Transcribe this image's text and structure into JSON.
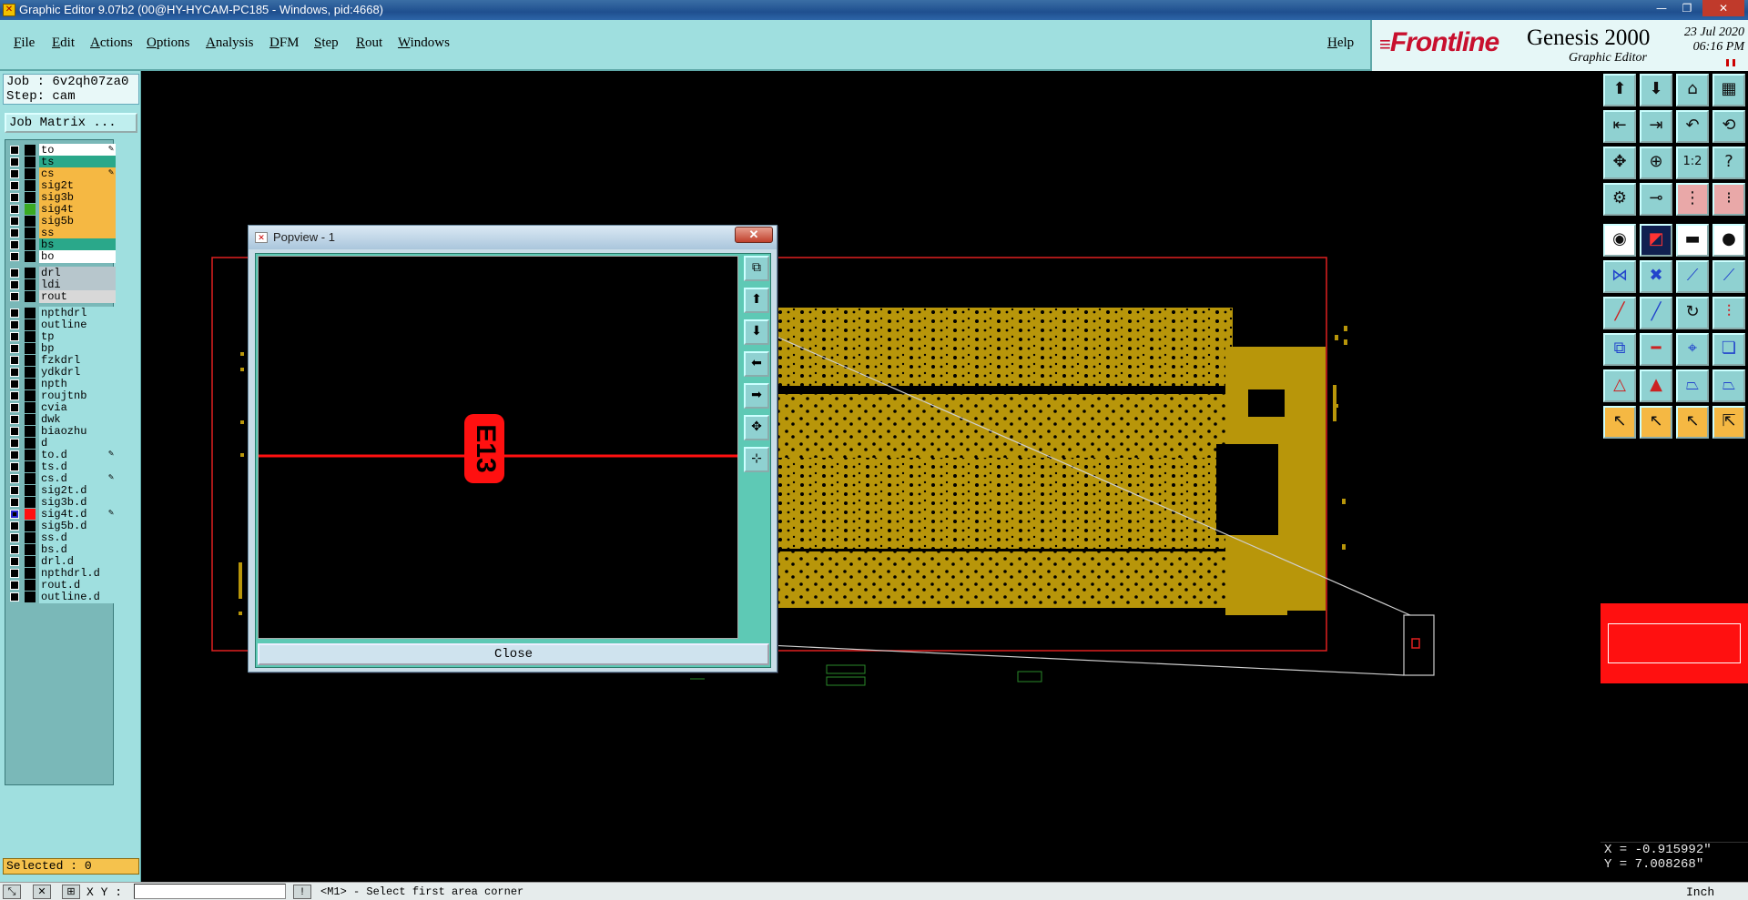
{
  "window": {
    "title": "Graphic Editor 9.07b2 (00@HY-HYCAM-PC185 - Windows, pid:4668)",
    "app_icon": "graphic-editor-icon",
    "controls": [
      "minimize",
      "restore",
      "close"
    ]
  },
  "menu": {
    "items": [
      "File",
      "Edit",
      "Actions",
      "Options",
      "Analysis",
      "DFM",
      "Step",
      "Rout",
      "Windows"
    ],
    "help": "Help"
  },
  "brand": {
    "logo": "Frontline",
    "product": "Genesis 2000",
    "subtitle": "Graphic Editor",
    "date": "23 Jul 2020",
    "time": "06:16 PM"
  },
  "left": {
    "job": "Job : 6v2qh07za0",
    "step": "Step: cam",
    "job_matrix": "Job Matrix ...",
    "selected": "Selected : 0",
    "layers": [
      {
        "name": "to",
        "bg": "#ffffff",
        "swatch": "",
        "edit": true
      },
      {
        "name": "ts",
        "bg": "#2aa88a",
        "swatch": "",
        "edit": false
      },
      {
        "name": "cs",
        "bg": "#f5b843",
        "swatch": "",
        "edit": true
      },
      {
        "name": "sig2t",
        "bg": "#f5b843",
        "swatch": "",
        "edit": false
      },
      {
        "name": "sig3b",
        "bg": "#f5b843",
        "swatch": "",
        "edit": false
      },
      {
        "name": "sig4t",
        "bg": "#f5b843",
        "swatch": "#3aaa22",
        "edit": false
      },
      {
        "name": "sig5b",
        "bg": "#f5b843",
        "swatch": "",
        "edit": false
      },
      {
        "name": "ss",
        "bg": "#f5b843",
        "swatch": "",
        "edit": false
      },
      {
        "name": "bs",
        "bg": "#2aa88a",
        "swatch": "",
        "edit": false
      },
      {
        "name": "bo",
        "bg": "#ffffff",
        "swatch": "",
        "edit": false
      },
      {
        "name": "drl",
        "bg": "#b7c6cc",
        "swatch": "",
        "edit": false
      },
      {
        "name": "ldi",
        "bg": "#b7c6cc",
        "swatch": "",
        "edit": false
      },
      {
        "name": "rout",
        "bg": "#d8d8d8",
        "swatch": "",
        "edit": false
      },
      {
        "name": "npthdrl",
        "bg": "#9fdfdf",
        "swatch": "",
        "edit": false
      },
      {
        "name": "outline",
        "bg": "#9fdfdf",
        "swatch": "",
        "edit": false
      },
      {
        "name": "tp",
        "bg": "#9fdfdf",
        "swatch": "",
        "edit": false
      },
      {
        "name": "bp",
        "bg": "#9fdfdf",
        "swatch": "",
        "edit": false
      },
      {
        "name": "fzkdrl",
        "bg": "#9fdfdf",
        "swatch": "",
        "edit": false
      },
      {
        "name": "ydkdrl",
        "bg": "#9fdfdf",
        "swatch": "",
        "edit": false
      },
      {
        "name": "npth",
        "bg": "#9fdfdf",
        "swatch": "",
        "edit": false
      },
      {
        "name": "roujtnb",
        "bg": "#9fdfdf",
        "swatch": "",
        "edit": false
      },
      {
        "name": "cvia",
        "bg": "#9fdfdf",
        "swatch": "",
        "edit": false
      },
      {
        "name": "dwk",
        "bg": "#9fdfdf",
        "swatch": "",
        "edit": false
      },
      {
        "name": "biaozhu",
        "bg": "#9fdfdf",
        "swatch": "",
        "edit": false
      },
      {
        "name": "d",
        "bg": "#9fdfdf",
        "swatch": "",
        "edit": false
      },
      {
        "name": "to.d",
        "bg": "#9fdfdf",
        "swatch": "",
        "edit": true
      },
      {
        "name": "ts.d",
        "bg": "#9fdfdf",
        "swatch": "",
        "edit": false
      },
      {
        "name": "cs.d",
        "bg": "#9fdfdf",
        "swatch": "",
        "edit": true
      },
      {
        "name": "sig2t.d",
        "bg": "#9fdfdf",
        "swatch": "",
        "edit": false
      },
      {
        "name": "sig3b.d",
        "bg": "#9fdfdf",
        "swatch": "",
        "edit": false
      },
      {
        "name": "sig4t.d",
        "bg": "#9fdfdf",
        "swatch": "#ff1010",
        "edit": true,
        "checked": true
      },
      {
        "name": "sig5b.d",
        "bg": "#9fdfdf",
        "swatch": "",
        "edit": false
      },
      {
        "name": "ss.d",
        "bg": "#9fdfdf",
        "swatch": "",
        "edit": false
      },
      {
        "name": "bs.d",
        "bg": "#9fdfdf",
        "swatch": "",
        "edit": false
      },
      {
        "name": "drl.d",
        "bg": "#9fdfdf",
        "swatch": "",
        "edit": false
      },
      {
        "name": "npthdrl.d",
        "bg": "#9fdfdf",
        "swatch": "",
        "edit": false
      },
      {
        "name": "rout.d",
        "bg": "#9fdfdf",
        "swatch": "",
        "edit": false
      },
      {
        "name": "outline.d",
        "bg": "#9fdfdf",
        "swatch": "",
        "edit": false
      }
    ]
  },
  "popview": {
    "title": "Popview - 1",
    "close_x": "✕",
    "close_button": "Close",
    "feature_text": "E13"
  },
  "right": {
    "coord_x": "X = -0.915992\"",
    "coord_y": "Y = 7.008268\"",
    "units": "Inch"
  },
  "status": {
    "xy_label": "X Y :",
    "xy_value": "",
    "message": "<M1> - Select first area corner"
  },
  "colors": {
    "accent_teal": "#9fdfdf",
    "board_gold": "#b8960a",
    "highlight_red": "#ff1010"
  }
}
